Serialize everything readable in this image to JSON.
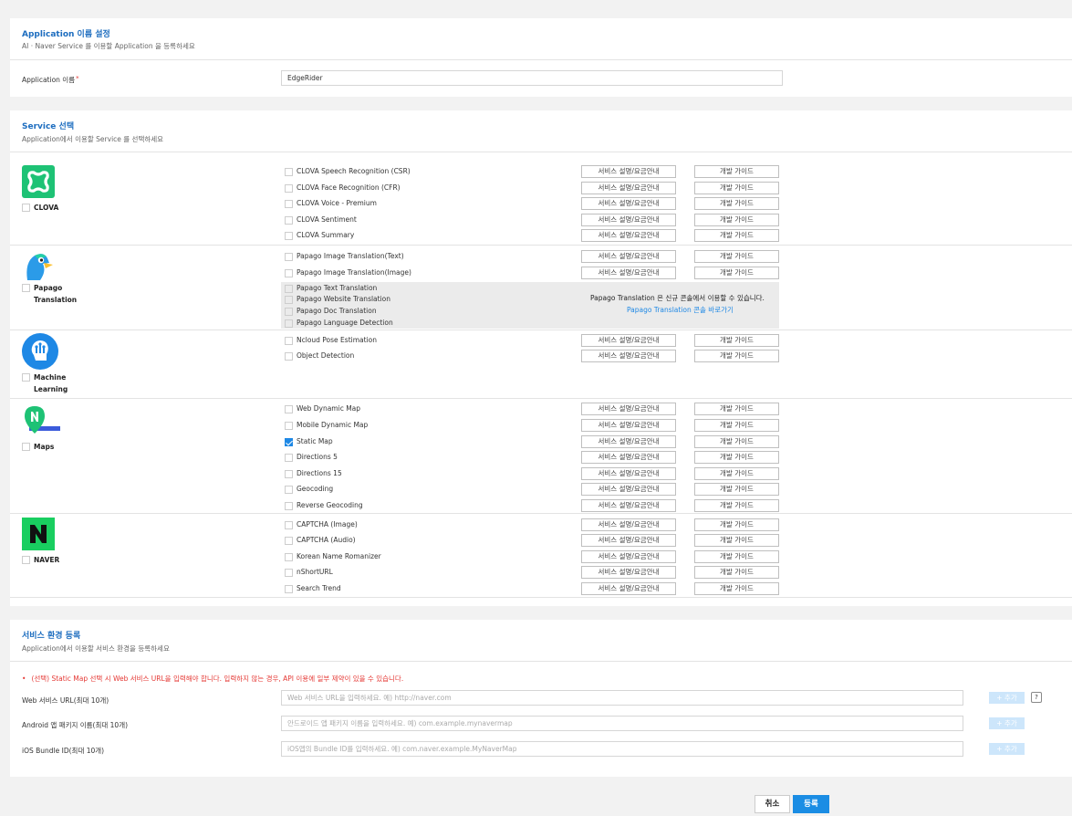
{
  "app_section": {
    "title": "Application 이름 설정",
    "subtitle": "AI · Naver Service 를 이용할 Application 을 등록하세요",
    "name_label": "Application 이름",
    "required_mark": "*",
    "name_value": "EdgeRider"
  },
  "service_section": {
    "title": "Service 선택",
    "subtitle": "Application에서 이용할 Service 를 선택하세요",
    "desc_button": "서비스 설명/요금안내",
    "guide_button": "개발 가이드",
    "groups": [
      {
        "name": "CLOVA",
        "icon": "clova-icon",
        "color": "#1ec275",
        "services": [
          {
            "name": "CLOVA Speech Recognition (CSR)",
            "checked": false
          },
          {
            "name": "CLOVA Face Recognition (CFR)",
            "checked": false
          },
          {
            "name": "CLOVA Voice - Premium",
            "checked": false
          },
          {
            "name": "CLOVA Sentiment",
            "checked": false
          },
          {
            "name": "CLOVA Summary",
            "checked": false
          }
        ]
      },
      {
        "name_line1": "Papago",
        "name_line2": "Translation",
        "icon": "papago-bird-icon",
        "color": "#2b9be8",
        "services": [
          {
            "name": "Papago Image Translation(Text)",
            "checked": false
          },
          {
            "name": "Papago Image Translation(Image)",
            "checked": false
          }
        ],
        "disabled_services": [
          "Papago Text Translation",
          "Papago Website Translation",
          "Papago Doc Translation",
          "Papago Language Detection"
        ],
        "disabled_notice": "Papago Translation 은 신규 콘솔에서 이용할 수 있습니다.",
        "disabled_link": "Papago Translation 콘솔 바로가기"
      },
      {
        "name_line1": "Machine",
        "name_line2": "Learning",
        "icon": "machine-learning-icon",
        "color": "#1e88e5",
        "services": [
          {
            "name": "Ncloud Pose Estimation",
            "checked": false
          },
          {
            "name": "Object Detection",
            "checked": false
          }
        ]
      },
      {
        "name": "Maps",
        "icon": "maps-pin-icon",
        "color": "#1ec275",
        "services": [
          {
            "name": "Web Dynamic Map",
            "checked": false
          },
          {
            "name": "Mobile Dynamic Map",
            "checked": false
          },
          {
            "name": "Static Map",
            "checked": true
          },
          {
            "name": "Directions 5",
            "checked": false
          },
          {
            "name": "Directions 15",
            "checked": false
          },
          {
            "name": "Geocoding",
            "checked": false
          },
          {
            "name": "Reverse Geocoding",
            "checked": false
          }
        ]
      },
      {
        "name": "NAVER",
        "icon": "naver-n-icon",
        "color": "#19ce60",
        "services": [
          {
            "name": "CAPTCHA (Image)",
            "checked": false
          },
          {
            "name": "CAPTCHA (Audio)",
            "checked": false
          },
          {
            "name": "Korean Name Romanizer",
            "checked": false
          },
          {
            "name": "nShortURL",
            "checked": false
          },
          {
            "name": "Search Trend",
            "checked": false
          }
        ]
      }
    ]
  },
  "env_section": {
    "title": "서비스 환경 등록",
    "subtitle": "Application에서 이용할 서비스 환경을 등록하세요",
    "notice_bullet": "•",
    "notice": "(선택) Static Map 선택 시 Web 서비스 URL을 입력해야 합니다. 입력하지 않는 경우, API 이용에 일부 제약이 있을 수 있습니다.",
    "add_label": "+ 추가",
    "help_icon": "?",
    "fields": [
      {
        "label": "Web 서비스 URL(최대 10개)",
        "placeholder": "Web 서비스 URL을 입력하세요. 예) http://naver.com"
      },
      {
        "label": "Android 앱 패키지 이름(최대 10개)",
        "placeholder": "안드로이드 앱 패키지 이름을 입력하세요. 예) com.example.mynavermap"
      },
      {
        "label": "iOS Bundle ID(최대 10개)",
        "placeholder": "iOS앱의 Bundle ID를 입력하세요. 예) com.naver.example.MyNaverMap"
      }
    ]
  },
  "footer": {
    "cancel": "취소",
    "submit": "등록"
  },
  "colors": {
    "accent": "#1d6dbf",
    "primary_button": "#1b8de4",
    "error": "#e53935"
  }
}
